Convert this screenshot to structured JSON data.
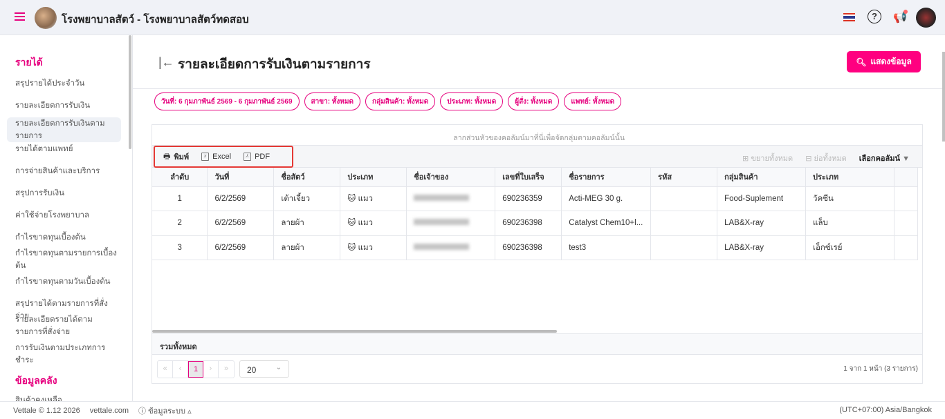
{
  "header": {
    "title": "โรงพยาบาลสัตว์ - โรงพยาบาลสัตว์ทดสอบ"
  },
  "sidebar": {
    "sections": [
      {
        "title": "รายได้"
      },
      {
        "title": "ข้อมูลคลัง"
      }
    ],
    "items": [
      "สรุปรายได้ประจำวัน",
      "รายละเอียดการรับเงิน",
      "รายละเอียดการรับเงินตามรายการ",
      "รายได้ตามแพทย์",
      "การจ่ายสินค้าและบริการ",
      "สรุปการรับเงิน",
      "ค่าใช้จ่ายโรงพยาบาล",
      "กำไรขาดทุนเบื้องต้น",
      "กำไรขาดทุนตามรายการเบื้องต้น",
      "กำไรขาดทุนตามวันเบื้องต้น",
      "สรุปรายได้ตามรายการที่สั่งจ่าย",
      "รายละเอียดรายได้ตามรายการที่สั่งจ่าย",
      "การรับเงินตามประเภทการชำระ",
      "สินค้าคงเหลือ"
    ]
  },
  "page": {
    "title": "รายละเอียดการรับเงินตามรายการ",
    "show_button": "แสดงข้อมูล"
  },
  "filters": [
    "วันที่: 6 กุมภาพันธ์ 2569 - 6 กุมภาพันธ์ 2569",
    "สาขา: ทั้งหมด",
    "กลุ่มสินค้า: ทั้งหมด",
    "ประเภท: ทั้งหมด",
    "ผู้สั่ง: ทั้งหมด",
    "แพทย์: ทั้งหมด"
  ],
  "grid": {
    "group_hint": "ลากส่วนหัวของคอลัมน์มาที่นี่เพื่อจัดกลุ่มตามคอลัมน์นั้น",
    "toolbar": {
      "print": "พิมพ์",
      "excel": "Excel",
      "pdf": "PDF",
      "expand_all": "ขยายทั้งหมด",
      "collapse_all": "ย่อทั้งหมด",
      "choose_columns": "เลือกคอลัมน์"
    },
    "columns": [
      "ลำดับ",
      "วันที่",
      "ชื่อสัตว์",
      "ประเภท",
      "ชื่อเจ้าของ",
      "เลขที่ใบเสร็จ",
      "ชื่อรายการ",
      "รหัส",
      "กลุ่มสินค้า",
      "ประเภท"
    ],
    "rows": [
      [
        "1",
        "6/2/2569",
        "เต้าเจี้ยว",
        "แมว",
        "",
        "690236359",
        "Acti-MEG 30 g.",
        "",
        "Food-Suplement",
        "วัคซีน"
      ],
      [
        "2",
        "6/2/2569",
        "ลายผ้า",
        "แมว",
        "",
        "690236398",
        "Catalyst Chem10+l...",
        "",
        "LAB&X-ray",
        "แล็บ"
      ],
      [
        "3",
        "6/2/2569",
        "ลายผ้า",
        "แมว",
        "",
        "690236398",
        "test3",
        "",
        "LAB&X-ray",
        "เอ็กซ์เรย์"
      ]
    ],
    "total_label": "รวมทั้งหมด",
    "pager": {
      "current": "1",
      "page_size": "20",
      "info": "1 จาก 1 หน้า (3 รายการ)"
    }
  },
  "footer": {
    "version": "Vettale © 1.12 2026",
    "site": "vettale.com",
    "sysinfo": "ข้อมูลระบบ",
    "timezone": "(UTC+07:00) Asia/Bangkok"
  },
  "colors": {
    "accent": "#e6007e",
    "button": "#ff0080"
  }
}
